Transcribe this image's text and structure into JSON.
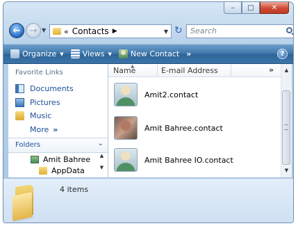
{
  "window": {
    "caption_buttons": {
      "minimize": "–",
      "maximize": "□",
      "close": "✕"
    }
  },
  "address": {
    "back_icon": "←",
    "forward_icon": "→",
    "recent_icon": "▼",
    "chevrons": "«",
    "location": "Contacts",
    "separator": "▶",
    "dropdown": "▼",
    "refresh_icon": "↻",
    "search_placeholder": "Search"
  },
  "toolbar": {
    "organize": "Organize",
    "views": "Views",
    "new_contact": "New Contact",
    "more": "»",
    "help": "?",
    "arrow": "▼"
  },
  "nav": {
    "favorites_title": "Favorite Links",
    "links": [
      {
        "label": "Documents",
        "icon": "documents-icon"
      },
      {
        "label": "Pictures",
        "icon": "pictures-icon"
      },
      {
        "label": "Music",
        "icon": "music-folder-icon"
      }
    ],
    "more": "More",
    "more_chevron": "»",
    "folders_title": "Folders",
    "folders_toggle": "⌄",
    "tree": [
      {
        "label": "Amit Bahree",
        "icon": "user-folder-icon"
      },
      {
        "label": "AppData",
        "icon": "folder-icon"
      }
    ],
    "scroll_up": "▲",
    "scroll_down": "▼"
  },
  "columns": {
    "name": "Name",
    "email": "E-mail Address",
    "more": "»",
    "sort_indicator": "▲"
  },
  "files": [
    {
      "name": "Amit2.contact",
      "icon": "contact-icon"
    },
    {
      "name": "Amit Bahree.contact",
      "icon": "contact-photo-icon"
    },
    {
      "name": "Amit Bahree IO.contact",
      "icon": "contact-icon"
    }
  ],
  "scrollbar": {
    "up": "▲",
    "down": "▼"
  },
  "details": {
    "item_count": "4 items",
    "icon": "folder-large-icon"
  }
}
